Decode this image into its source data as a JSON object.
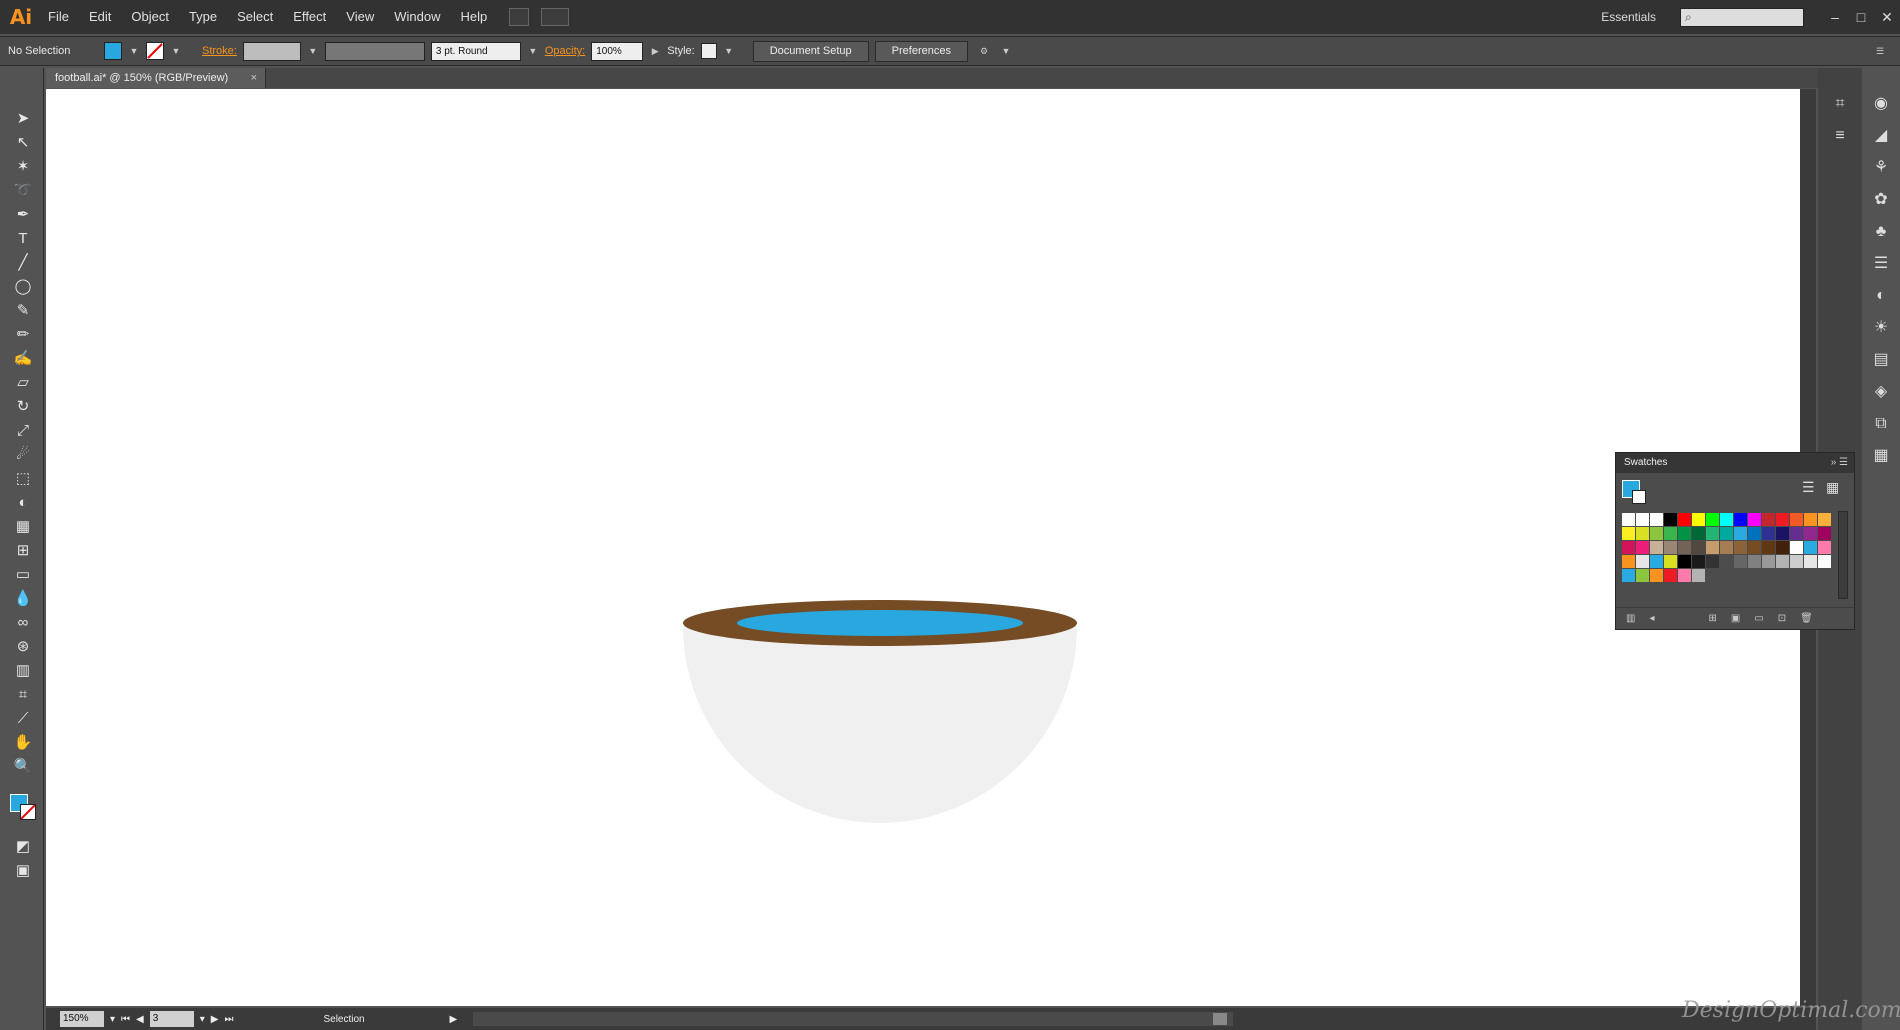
{
  "app": {
    "logo": "Ai"
  },
  "menu": [
    "File",
    "Edit",
    "Object",
    "Type",
    "Select",
    "Effect",
    "View",
    "Window",
    "Help"
  ],
  "workspace": "Essentials",
  "control": {
    "selection": "No Selection",
    "stroke_label": "Stroke:",
    "brush": "3 pt. Round",
    "opacity_label": "Opacity:",
    "opacity_value": "100%",
    "style_label": "Style:",
    "document_setup": "Document Setup",
    "preferences": "Preferences",
    "fill_color": "#29a8e0"
  },
  "document": {
    "tab": "football.ai* @ 150% (RGB/Preview)"
  },
  "status": {
    "zoom": "150%",
    "artboard": "3",
    "tool": "Selection"
  },
  "swatches": {
    "title": "Swatches",
    "colors": [
      "#ffffff",
      "#ffffff",
      "#ffffff",
      "#000000",
      "#ff0000",
      "#ffff00",
      "#00ff00",
      "#00ffff",
      "#0000ff",
      "#ff00ff",
      "#c1272d",
      "#ed1c24",
      "#f15a24",
      "#f7931e",
      "#fbb03b",
      "#fcee21",
      "#d9e021",
      "#8cc63f",
      "#39b54a",
      "#009245",
      "#006837",
      "#22b573",
      "#00a99d",
      "#29abe2",
      "#0071bc",
      "#2e3192",
      "#1b1464",
      "#662d91",
      "#93278f",
      "#9e005d",
      "#d4145a",
      "#ed1e79",
      "#c7b299",
      "#998675",
      "#736357",
      "#534741",
      "#c69c6d",
      "#a67c52",
      "#8c6239",
      "#754c24",
      "#603813",
      "#42210b",
      "#ffffff",
      "#29abe2",
      "#ff7bac",
      "#f7931e",
      "#e6e6e6",
      "#29abe2",
      "#d9e021",
      "#000000",
      "#1a1a1a",
      "#333333",
      "#4d4d4d",
      "#666666",
      "#808080",
      "#999999",
      "#b3b3b3",
      "#cccccc",
      "#e6e6e6",
      "#ffffff",
      "#29abe2",
      "#8cc63f",
      "#f7931e",
      "#ed1c24",
      "#ff7bac",
      "#b3b3b3"
    ]
  },
  "watermark": "DesignOptimal.com"
}
